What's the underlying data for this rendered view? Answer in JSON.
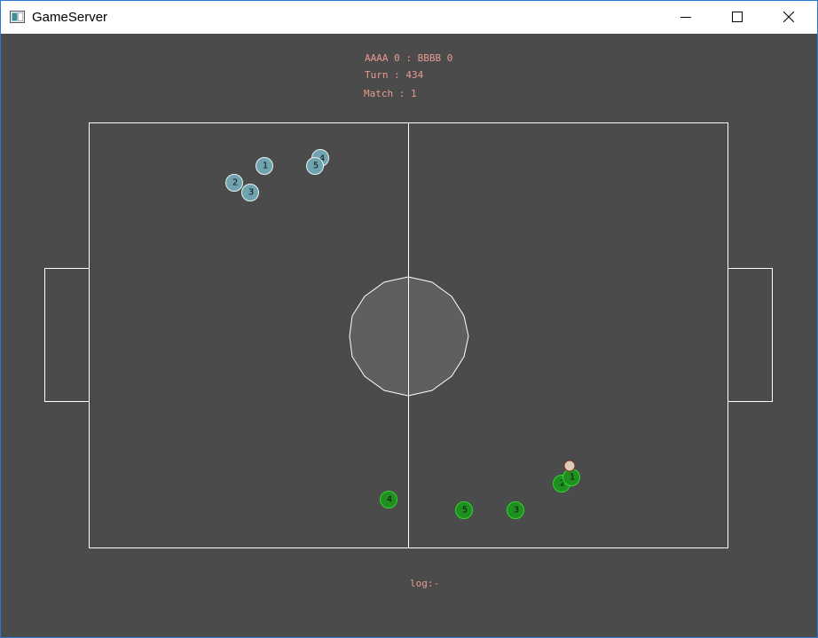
{
  "window": {
    "title": "GameServer"
  },
  "hud": {
    "score": "AAAA 0 : BBBB 0",
    "turn": "Turn : 434",
    "match": "Match : 1",
    "log": "log:-"
  },
  "colors": {
    "background": "#4b4b4b",
    "lines": "#ffffff",
    "center_circle": "#5f5f5f",
    "team_a": "#6fa3ad",
    "team_b": "#1f8f1f",
    "hud_text": "#e89a92",
    "ball": "#e0d6c4"
  },
  "players": {
    "team_a": [
      {
        "number": "1"
      },
      {
        "number": "2"
      },
      {
        "number": "3"
      },
      {
        "number": "4"
      },
      {
        "number": "5"
      }
    ],
    "team_b": [
      {
        "number": "1"
      },
      {
        "number": "2"
      },
      {
        "number": "3"
      },
      {
        "number": "4"
      },
      {
        "number": "5"
      }
    ]
  }
}
